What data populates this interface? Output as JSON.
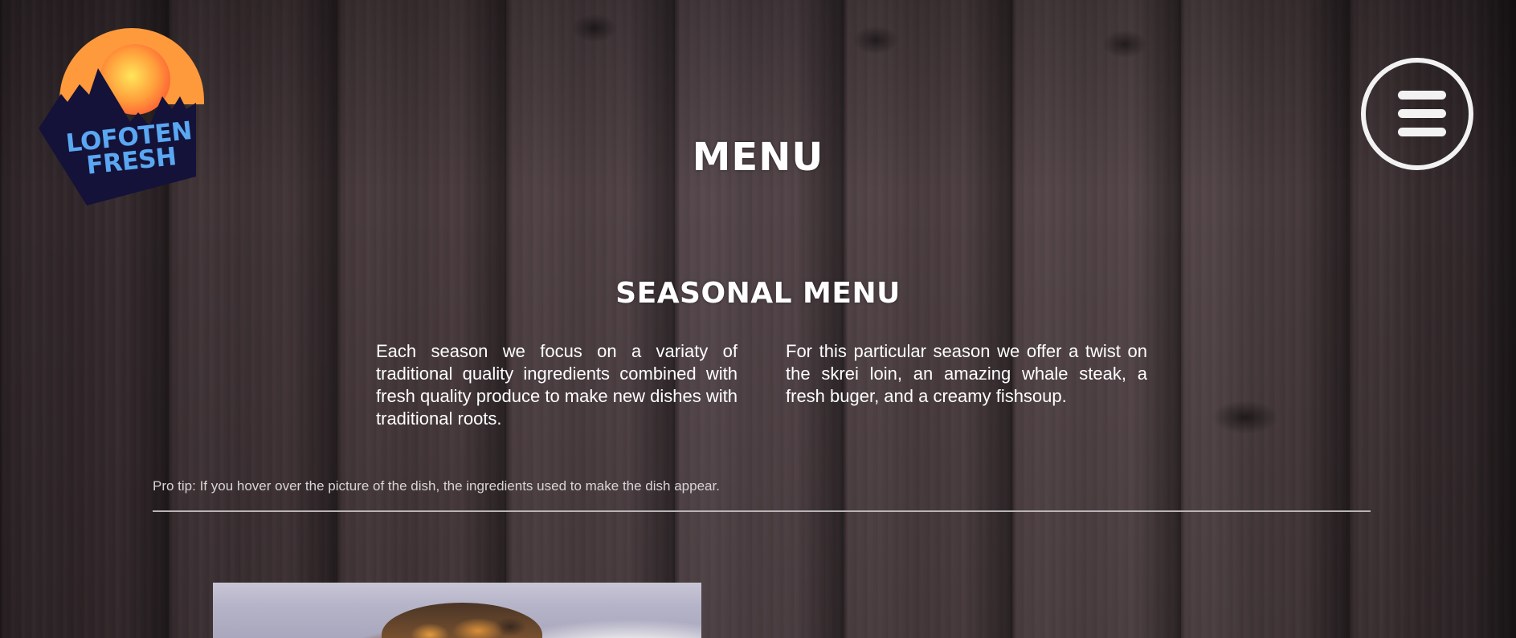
{
  "logo": {
    "line1": "LOFOTEN",
    "line2": "FRESH"
  },
  "header": {
    "title": "MENU",
    "menu_icon": "hamburger-menu-icon"
  },
  "seasonal": {
    "title": "SEASONAL MENU",
    "left_text": "Each season we focus on a variaty of traditional quality ingredients combined with fresh quality produce to make new dishes with traditional roots.",
    "right_text": "For this particular season we offer a twist on the skrei loin, an amazing whale steak, a fresh buger, and a creamy fishsoup."
  },
  "pro_tip": "Pro tip: If you hover over the picture of the dish, the ingredients used to make the dish appear.",
  "colors": {
    "logo_sun_top": "#ffe14a",
    "logo_sun_bottom": "#ff7a3a",
    "logo_mountain": "#141238",
    "logo_text": "#5aa7f2",
    "menu_button": "#f2f2f2"
  }
}
